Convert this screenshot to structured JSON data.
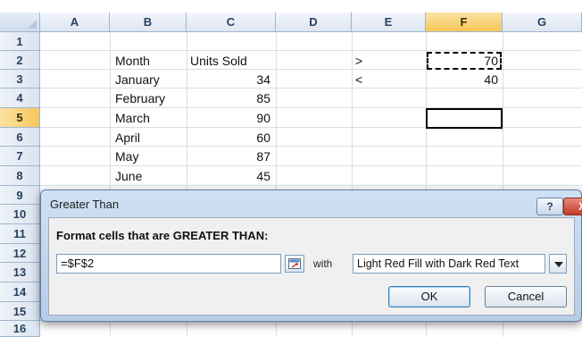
{
  "columns": [
    "A",
    "B",
    "C",
    "D",
    "E",
    "F",
    "G"
  ],
  "rows": [
    "1",
    "2",
    "3",
    "4",
    "5",
    "6",
    "7",
    "8",
    "9",
    "10",
    "11",
    "12",
    "13",
    "14",
    "15",
    "16"
  ],
  "selected_column": "F",
  "selected_row": "5",
  "cells": {
    "B2": "Month",
    "C2": "Units Sold",
    "E2": ">",
    "F2": "70",
    "B3": "January",
    "C3": "34",
    "E3": "<",
    "F3": "40",
    "B4": "February",
    "C4": "85",
    "B5": "March",
    "C5": "90",
    "B6": "April",
    "C6": "60",
    "B7": "May",
    "C7": "87",
    "B8": "June",
    "C8": "45"
  },
  "dialog": {
    "title": "Greater Than",
    "help": "?",
    "close": "X",
    "prompt": "Format cells that are GREATER THAN:",
    "reference_value": "=$F$2",
    "with_label": "with",
    "format_selected": "Light Red Fill with Dark Red Text",
    "ok": "OK",
    "cancel": "Cancel"
  },
  "colors": {
    "selected_header": "#f6c658",
    "header": "#dde6f2",
    "dialog": "#b7cce6"
  },
  "icons": {
    "ref_button": "collapse-dialog-icon",
    "dropdown": "chevron-down-icon"
  }
}
